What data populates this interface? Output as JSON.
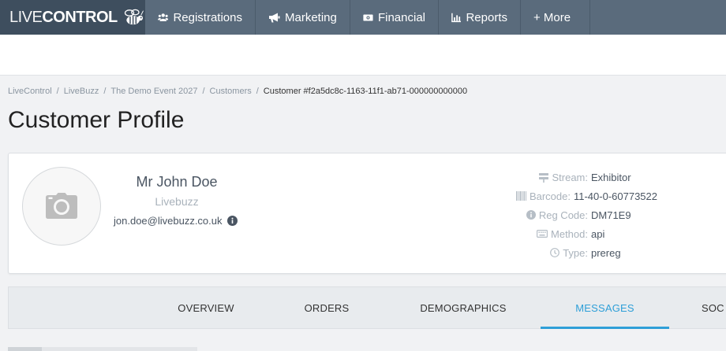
{
  "brand": {
    "part1": "LIVE",
    "part2": "CONTROL"
  },
  "nav": {
    "registrations": "Registrations",
    "marketing": "Marketing",
    "financial": "Financial",
    "reports": "Reports",
    "more": "+ More"
  },
  "breadcrumb": {
    "items": [
      "LiveControl",
      "LiveBuzz",
      "The Demo Event 2027",
      "Customers"
    ],
    "current": "Customer #f2a5dc8c-1163-11f1-ab71-000000000000"
  },
  "page_title": "Customer Profile",
  "profile": {
    "name": "Mr John Doe",
    "company": "Livebuzz",
    "email": "jon.doe@livebuzz.co.uk"
  },
  "details": {
    "stream_label": "Stream:",
    "stream_value": "Exhibitor",
    "barcode_label": "Barcode:",
    "barcode_value": "11-40-0-60773522",
    "regcode_label": "Reg Code:",
    "regcode_value": "DM71E9",
    "method_label": "Method:",
    "method_value": "api",
    "type_label": "Type:",
    "type_value": "prereg"
  },
  "tabs": [
    "OVERVIEW",
    "ORDERS",
    "DEMOGRAPHICS",
    "MESSAGES",
    "SOC"
  ],
  "active_tab": "MESSAGES",
  "colors": {
    "nav_bg": "#5a6b7c",
    "brand_bg": "#3e4e5e",
    "accent": "#2e9fd8"
  }
}
